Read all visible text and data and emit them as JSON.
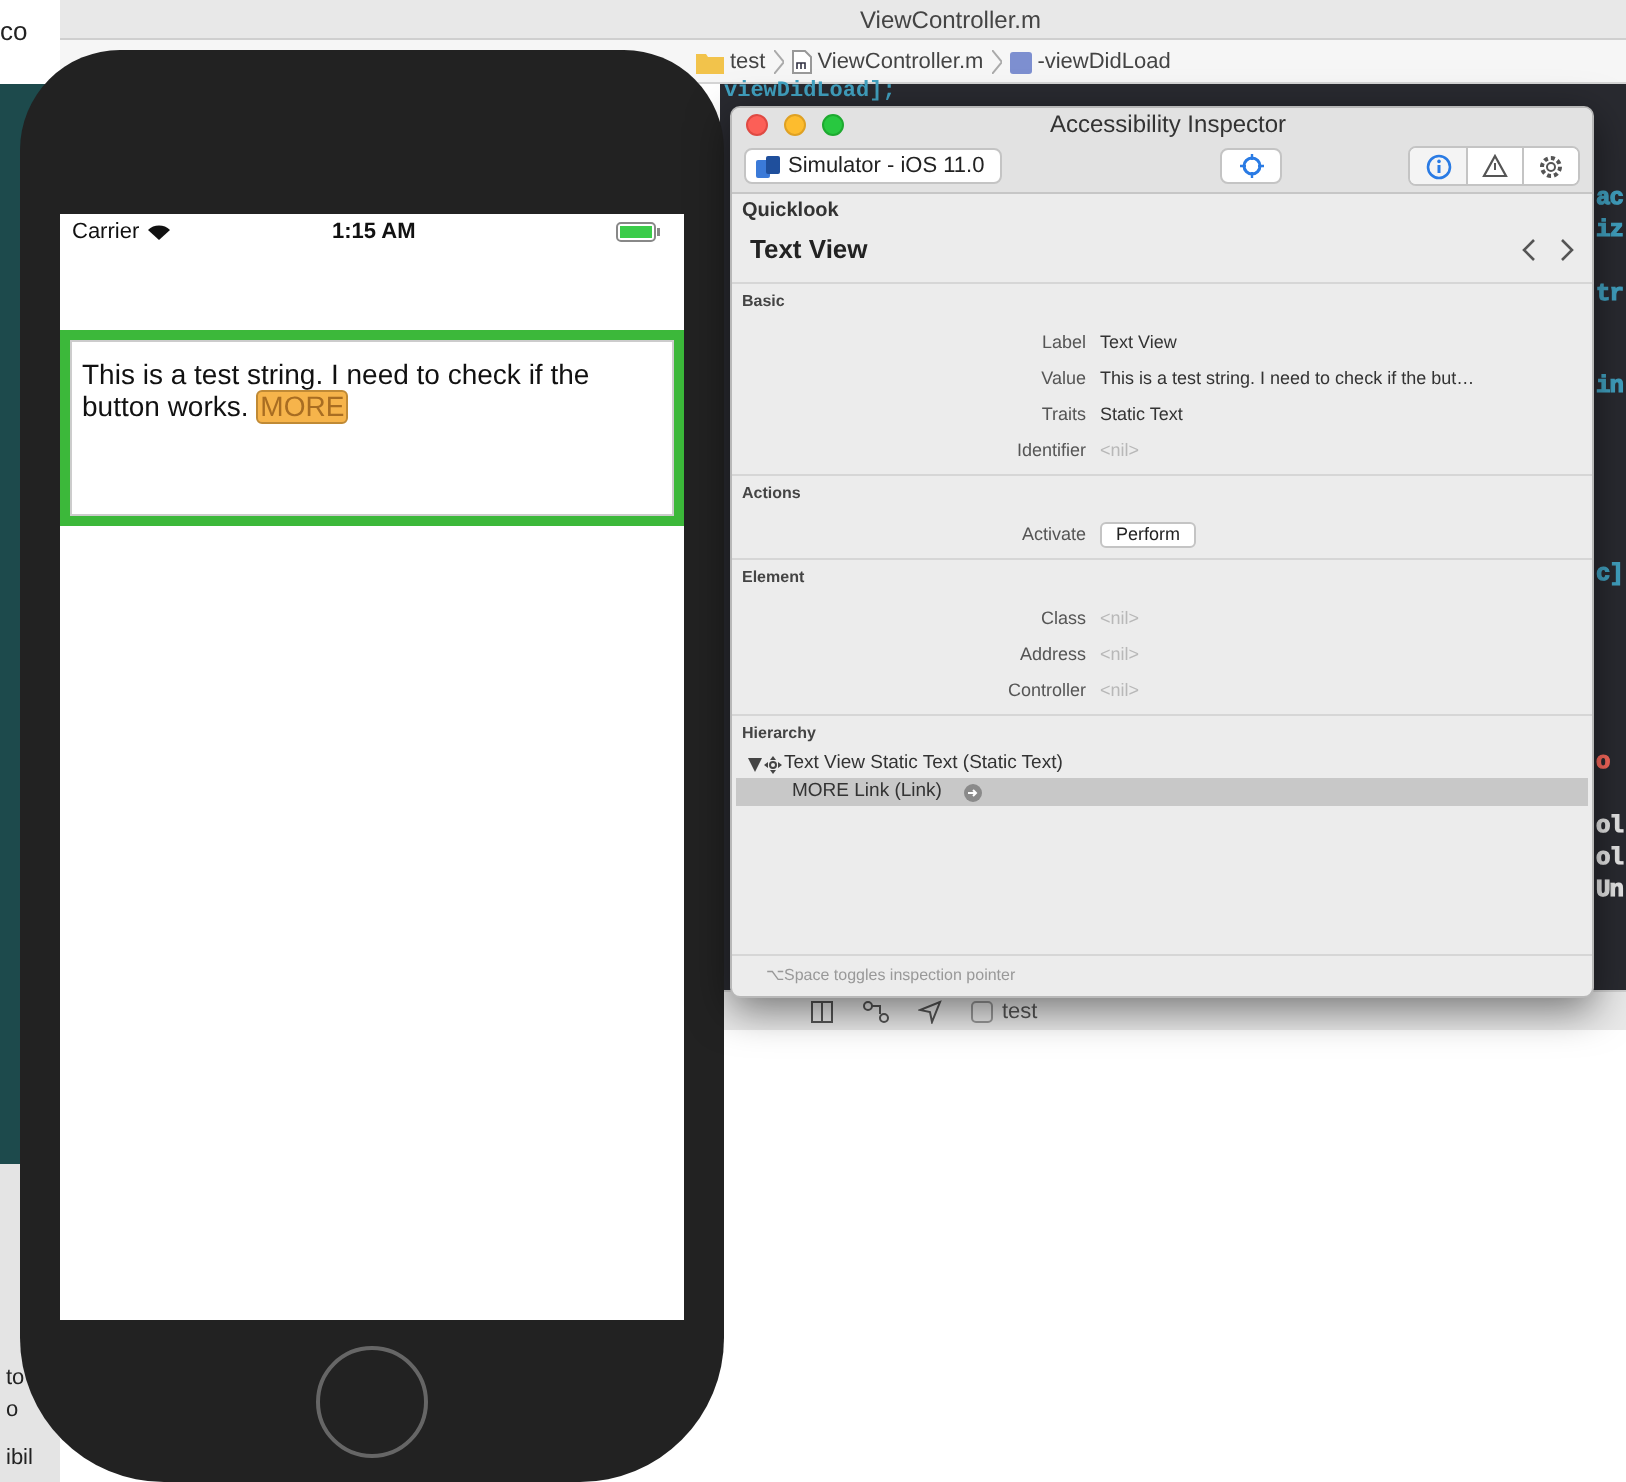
{
  "xcode": {
    "title": "ViewController.m",
    "left_fragment": "co",
    "breadcrumbs": [
      {
        "kind": "folder",
        "label": "test"
      },
      {
        "kind": "file",
        "label": "ViewController.m"
      },
      {
        "kind": "method",
        "label": "-viewDidLoad"
      }
    ],
    "top_code": "viewDidLoad];",
    "code_fragments": [
      {
        "text": "ac",
        "kind": "identifier"
      },
      {
        "text": "iz",
        "kind": "identifier"
      },
      {
        "text": "tr",
        "kind": "identifier"
      },
      {
        "text": "in",
        "kind": "identifier"
      },
      {
        "text": "c]",
        "kind": "identifier"
      },
      {
        "text": "o",
        "kind": "string"
      },
      {
        "text": "ol",
        "kind": "plain"
      },
      {
        "text": "ol",
        "kind": "plain"
      },
      {
        "text": "Un",
        "kind": "plain"
      }
    ],
    "debug_target": "test",
    "bottom_fragments": [
      "to",
      "o",
      "ibil"
    ]
  },
  "simulator": {
    "status_bar": {
      "carrier": "Carrier",
      "time": "1:15 AM"
    },
    "text_view": {
      "text": "This is a test string. I need to check if the button works.",
      "link": "MORE"
    }
  },
  "inspector": {
    "title": "Accessibility Inspector",
    "target": "Simulator - iOS 11.0",
    "tabs": [
      {
        "kind": "info",
        "selected": true
      },
      {
        "kind": "warning",
        "selected": false
      },
      {
        "kind": "settings",
        "selected": false
      }
    ],
    "quicklook": {
      "heading": "Quicklook",
      "title": "Text View"
    },
    "sections": [
      {
        "title": "Basic",
        "rows": [
          {
            "kind": "text",
            "label": "Label",
            "value": "Text View",
            "dimmed": false
          },
          {
            "kind": "text",
            "label": "Value",
            "value": "This is a test string. I need to check if the but…",
            "dimmed": false
          },
          {
            "kind": "text",
            "label": "Traits",
            "value": "Static Text",
            "dimmed": false
          },
          {
            "kind": "text",
            "label": "Identifier",
            "value": "<nil>",
            "dimmed": true
          }
        ]
      },
      {
        "title": "Actions",
        "rows": [
          {
            "kind": "button",
            "label": "Activate",
            "value": "Perform"
          }
        ]
      },
      {
        "title": "Element",
        "rows": [
          {
            "kind": "text",
            "label": "Class",
            "value": "<nil>",
            "dimmed": true
          },
          {
            "kind": "text",
            "label": "Address",
            "value": "<nil>",
            "dimmed": true
          },
          {
            "kind": "text",
            "label": "Controller",
            "value": "<nil>",
            "dimmed": true
          }
        ]
      }
    ],
    "hierarchy": {
      "title": "Hierarchy",
      "items": [
        {
          "label": "Text View Static Text (Static Text)",
          "expanded": true,
          "selected": false,
          "children": [
            {
              "label": "MORE Link (Link)",
              "selected": true
            }
          ]
        }
      ]
    },
    "footer": "⌥Space toggles inspection pointer"
  }
}
